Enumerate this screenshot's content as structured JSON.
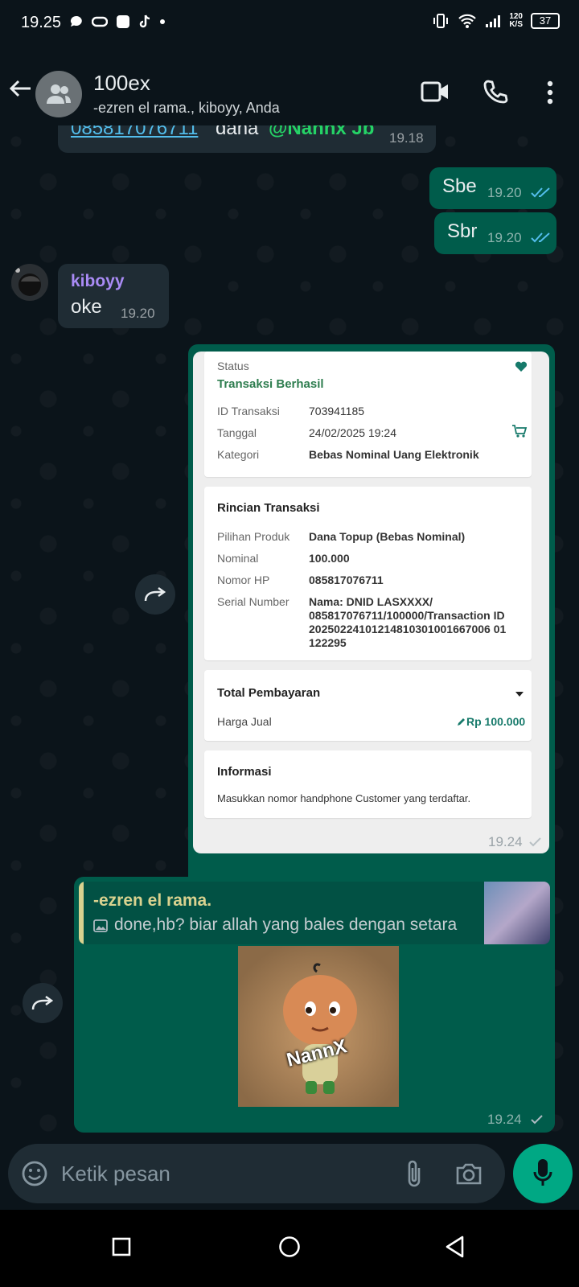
{
  "status_bar": {
    "time": "19.25",
    "net_speed_value": "120",
    "net_speed_unit": "K/S",
    "battery": "37"
  },
  "header": {
    "title": "100ex",
    "subtitle": "-ezren el rama., kiboyy, Anda"
  },
  "messages": {
    "partial": {
      "phone": "085817076711",
      "word": "dana",
      "mention": "@Nannx Jb",
      "time": "19.18"
    },
    "out1": {
      "text": "Sbe",
      "time": "19.20"
    },
    "out2": {
      "text": "Sbr",
      "time": "19.20"
    },
    "in1": {
      "sender": "kiboyy",
      "text": "oke",
      "time": "19.20"
    },
    "receipt_time": "19.24",
    "reply": {
      "quoted_sender": "-ezren el rama.",
      "quoted_text": "done,hb? biar allah yang bales dengan setara",
      "sticker_text": "NannX",
      "time": "19.24"
    }
  },
  "receipt": {
    "status_label": "Status",
    "status_value": "Transaksi Berhasil",
    "id_label": "ID Transaksi",
    "id_value": "703941185",
    "date_label": "Tanggal",
    "date_value": "24/02/2025 19:24",
    "category_label": "Kategori",
    "category_value": "Bebas Nominal Uang Elektronik",
    "details_title": "Rincian Transaksi",
    "product_label": "Pilihan Produk",
    "product_value": "Dana Topup (Bebas Nominal)",
    "nominal_label": "Nominal",
    "nominal_value": "100.000",
    "phone_label": "Nomor HP",
    "phone_value": "085817076711",
    "serial_label": "Serial Number",
    "serial_line1": "Nama: DNID LASXXXX/",
    "serial_line2": "085817076711/100000/Transaction ID",
    "serial_line3": "20250224101214810301001667006 01",
    "serial_line4": "122295",
    "total_title": "Total Pembayaran",
    "price_label": "Harga Jual",
    "price_value": "Rp 100.000",
    "info_title": "Informasi",
    "info_text": "Masukkan nomor handphone Customer yang terdaftar."
  },
  "input": {
    "placeholder": "Ketik pesan"
  },
  "colors": {
    "accent": "#00a884",
    "out_bubble": "#005c4b",
    "in_bubble": "#1f2c34",
    "tick": "#53bdeb",
    "link": "#53bdeb",
    "receipt_green": "#2e7d4f"
  }
}
